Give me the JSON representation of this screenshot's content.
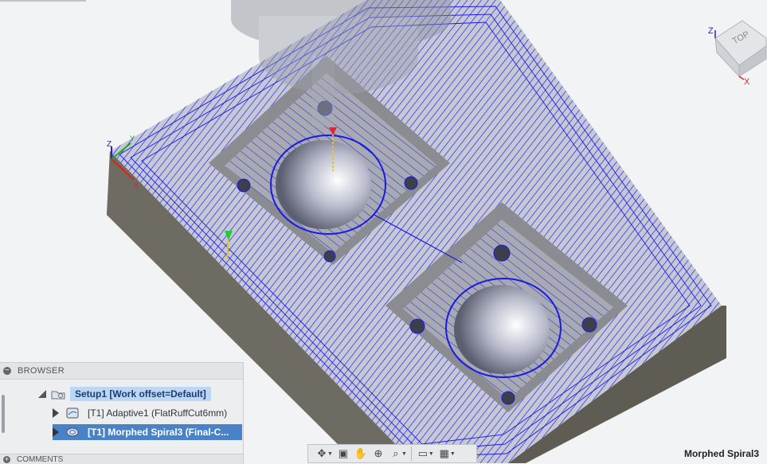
{
  "browser": {
    "title": "BROWSER",
    "setup": {
      "label": "Setup1 [Work offset=Default]"
    },
    "operations": [
      {
        "label": "[T1] Adaptive1 (FlatRuffCut6mm)",
        "selected": false
      },
      {
        "label": "[T1] Morphed Spiral3 (Final-C...",
        "selected": true
      }
    ]
  },
  "comments": {
    "title": "COMMENTS"
  },
  "viewcube": {
    "face_label": "TOP",
    "axis_z": "Z",
    "axis_x": "X"
  },
  "origin_axes": {
    "z": "Z",
    "y": "Y",
    "x": "X"
  },
  "toolbar": {
    "icons": [
      "orbit-icon",
      "look-at-icon",
      "pan-icon",
      "zoom-icon",
      "zoom-window-icon",
      "display-settings-icon",
      "grid-icon"
    ]
  },
  "status": {
    "active_operation": "Morphed Spiral3"
  },
  "colors": {
    "toolpath": "#1a1ae6",
    "stock_side": "#6e6b62",
    "background": "#f2f3f5",
    "selection": "#4a82c8"
  }
}
